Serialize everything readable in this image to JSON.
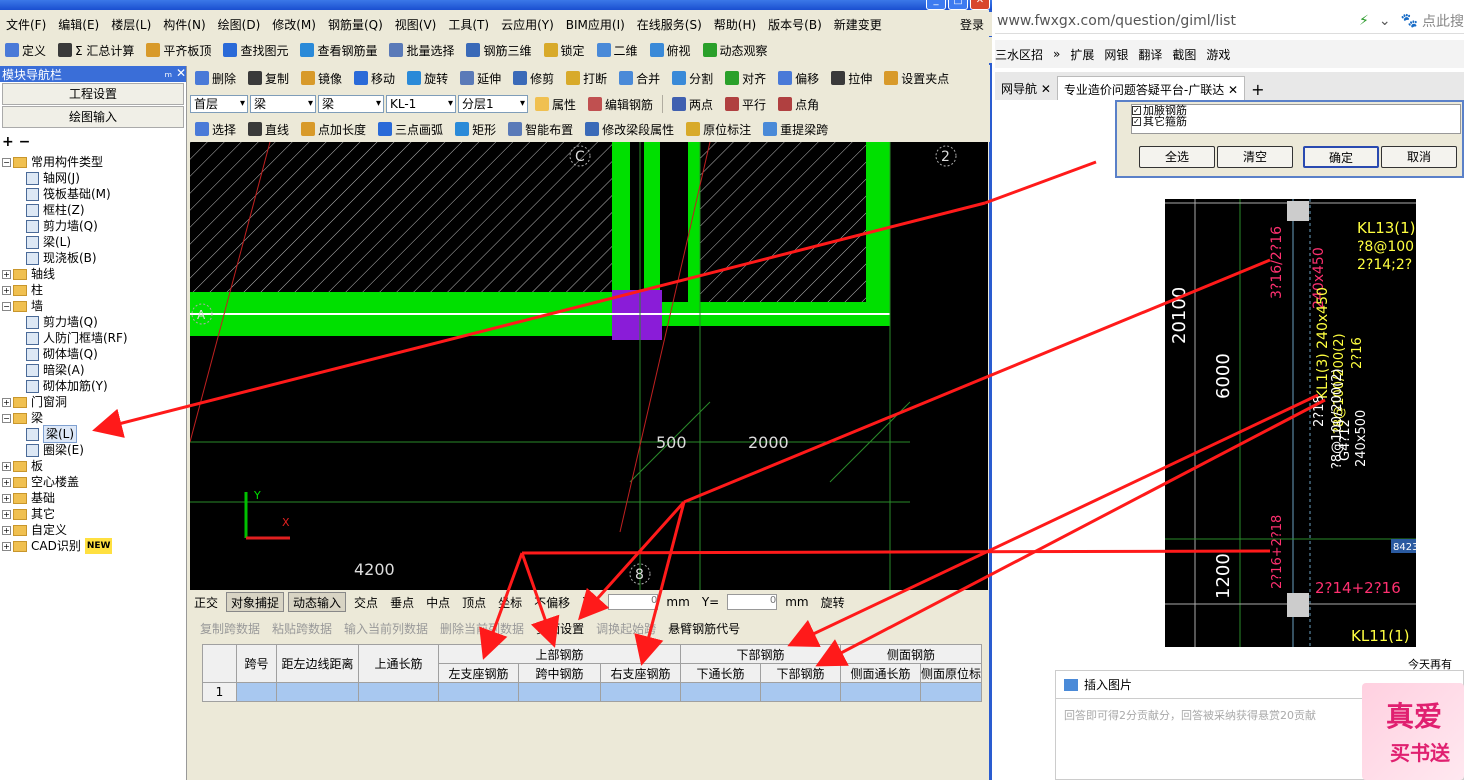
{
  "app": {
    "title_visible": "",
    "login": "登录",
    "menu": [
      "文件(F)",
      "编辑(E)",
      "楼层(L)",
      "构件(N)",
      "绘图(D)",
      "修改(M)",
      "钢筋量(Q)",
      "视图(V)",
      "工具(T)",
      "云应用(Y)",
      "BIM应用(I)",
      "在线服务(S)",
      "帮助(H)",
      "版本号(B)",
      "新建变更"
    ],
    "toolbar1": [
      "定义",
      "Σ 汇总计算",
      "平齐板顶",
      "查找图元",
      "查看钢筋量",
      "批量选择",
      "钢筋三维",
      "锁定",
      "二维",
      "俯视",
      "动态观察"
    ],
    "toolbar2": [
      "删除",
      "复制",
      "镜像",
      "移动",
      "旋转",
      "延伸",
      "修剪",
      "打断",
      "合并",
      "分割",
      "对齐",
      "偏移",
      "拉伸",
      "设置夹点"
    ],
    "toolbar3": {
      "floor": "首层",
      "type1": "梁",
      "type2": "梁",
      "name": "KL-1",
      "layer": "分层1",
      "prop": "属性",
      "edit_rebar": "编辑钢筋",
      "pts2": "两点",
      "parallel": "平行",
      "pt_angle": "点角"
    },
    "toolbar4": [
      "选择",
      "直线",
      "点加长度",
      "三点画弧",
      "矩形",
      "智能布置",
      "修改梁段属性",
      "原位标注",
      "重提梁跨"
    ],
    "nav": {
      "title": "模块导航栏",
      "pin": "ₘ",
      "close": "✕",
      "btn_settings": "工程设置",
      "btn_draw": "绘图输入",
      "tree": [
        {
          "label": "常用构件类型",
          "level": 0,
          "kind": "folder",
          "open": true
        },
        {
          "label": "轴网(J)",
          "level": 1,
          "kind": "leaf"
        },
        {
          "label": "筏板基础(M)",
          "level": 1,
          "kind": "leaf"
        },
        {
          "label": "框柱(Z)",
          "level": 1,
          "kind": "leaf"
        },
        {
          "label": "剪力墙(Q)",
          "level": 1,
          "kind": "leaf"
        },
        {
          "label": "梁(L)",
          "level": 1,
          "kind": "leaf"
        },
        {
          "label": "现浇板(B)",
          "level": 1,
          "kind": "leaf"
        },
        {
          "label": "轴线",
          "level": 0,
          "kind": "folder"
        },
        {
          "label": "柱",
          "level": 0,
          "kind": "folder"
        },
        {
          "label": "墙",
          "level": 0,
          "kind": "folder",
          "open": true
        },
        {
          "label": "剪力墙(Q)",
          "level": 1,
          "kind": "leaf"
        },
        {
          "label": "人防门框墙(RF)",
          "level": 1,
          "kind": "leaf"
        },
        {
          "label": "砌体墙(Q)",
          "level": 1,
          "kind": "leaf"
        },
        {
          "label": "暗梁(A)",
          "level": 1,
          "kind": "leaf"
        },
        {
          "label": "砌体加筋(Y)",
          "level": 1,
          "kind": "leaf"
        },
        {
          "label": "门窗洞",
          "level": 0,
          "kind": "folder"
        },
        {
          "label": "梁",
          "level": 0,
          "kind": "folder",
          "open": true
        },
        {
          "label": "梁(L)",
          "level": 1,
          "kind": "leaf",
          "selected": true
        },
        {
          "label": "圈梁(E)",
          "level": 1,
          "kind": "leaf"
        },
        {
          "label": "板",
          "level": 0,
          "kind": "folder"
        },
        {
          "label": "空心楼盖",
          "level": 0,
          "kind": "folder"
        },
        {
          "label": "基础",
          "level": 0,
          "kind": "folder"
        },
        {
          "label": "其它",
          "level": 0,
          "kind": "folder"
        },
        {
          "label": "自定义",
          "level": 0,
          "kind": "folder"
        },
        {
          "label": "CAD识别",
          "level": 0,
          "kind": "folder",
          "badge": "NEW"
        }
      ]
    },
    "canvas": {
      "axis_c": "C",
      "axis_2": "2",
      "axis_a": "A",
      "axis_8": "8",
      "dim_500": "500",
      "dim_2000": "2000",
      "dim_4200": "4200",
      "y": "Y",
      "x": "X"
    },
    "statusbar": [
      "正交",
      "对象捕捉",
      "动态输入",
      "交点",
      "垂点",
      "中点",
      "顶点",
      "坐标",
      "不偏移",
      "X=",
      "0",
      "mm",
      "Y=",
      "0",
      "mm",
      "旋转"
    ],
    "grid_toolbar": [
      "复制跨数据",
      "粘贴跨数据",
      "输入当前列数据",
      "删除当前列数据",
      "页面设置",
      "调换起始跨",
      "悬臂钢筋代号"
    ],
    "grid": {
      "h_span": "跨号",
      "h_dist": "距左边线距离",
      "h_top": "上通长筋",
      "h_upper": "上部钢筋",
      "h_lower": "下部钢筋",
      "h_side": "侧面钢筋",
      "h_left_seat": "左支座钢筋",
      "h_mid": "跨中钢筋",
      "h_right_seat": "右支座钢筋",
      "h_bottom_through": "下通长筋",
      "h_bottom": "下部钢筋",
      "h_side_through": "侧面通长筋",
      "h_side_orig": "侧面原位标",
      "row1": "1"
    }
  },
  "browser": {
    "url": "www.fwxgx.com/question/giml/list",
    "search": "点此搜",
    "bookmarks": [
      "三水区招",
      "»",
      "扩展",
      "网银",
      "翻译",
      "截图",
      "游戏"
    ],
    "tabs": [
      "网导航",
      "专业造价问题答疑平台-广联达"
    ],
    "dialog": {
      "chk1": "加腋钢筋",
      "chk2": "其它箍筋",
      "select_all": "全选",
      "clear": "清空",
      "ok": "确定",
      "cancel": "取消"
    },
    "cad": {
      "t1": "KL13(1)",
      "t2": "?8@100",
      "t3": "2?14;2?",
      "t4": "3?16/2?16",
      "t5": "240x450",
      "t6": "KL1(3) 240x450",
      "t7": "?8@100/200(2)",
      "t8": "2?16",
      "t9": "G4?12",
      "t10": "240x500",
      "t11": "2?18",
      "t12": "?8@100/200(2)",
      "t13": "20100",
      "t14": "6000",
      "t15": "1200",
      "t16": "2?16+2?18",
      "t17": "2?14+2?16",
      "t18": "KL11(1)",
      "t19": "8423"
    },
    "comment": {
      "insert_image": "插入图片",
      "placeholder": "回答即可得2分贡献分，回答被采纳获得悬赏20贡献",
      "side_text": "今天再有"
    },
    "ad": {
      "line1": "真爱",
      "line2": "买书送"
    }
  },
  "colors": {
    "green": "#00e000",
    "purple": "#8a1cd8",
    "red": "#ff1a1a",
    "cadtext": "#ff3070",
    "cadyellow": "#ffff40"
  }
}
